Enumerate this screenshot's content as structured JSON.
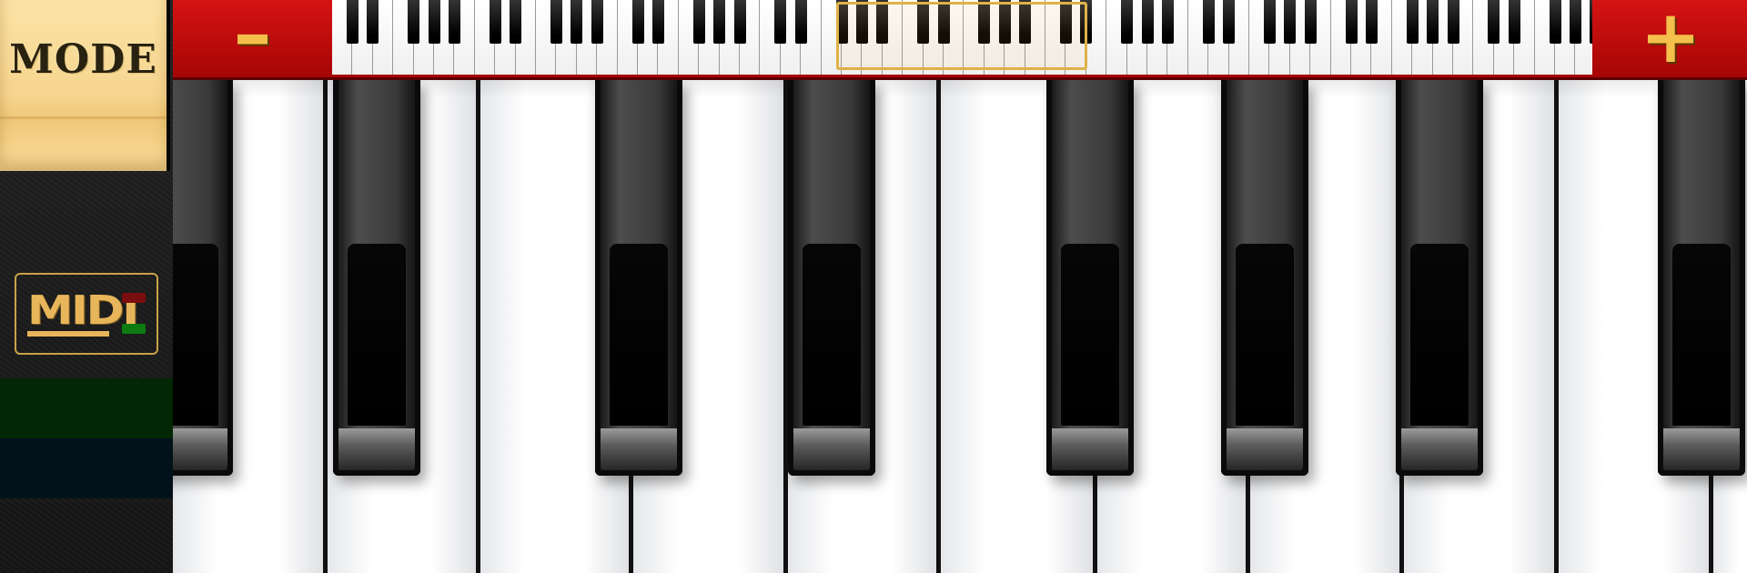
{
  "left_panel": {
    "mode_button": {
      "label": "MODE"
    },
    "midi_button": {
      "label": "MIDI",
      "led_in_color": "#7a0d0d",
      "led_out_color": "#0c7c12"
    }
  },
  "top_bar": {
    "zoom_out_symbol": "–",
    "zoom_in_symbol": "+",
    "accent_color": "#d51313",
    "highlight_color": "#e0b04a"
  },
  "keyboard": {
    "black_key_positions_in_octave": [
      0,
      1,
      3,
      4,
      5
    ],
    "visible_white_keys": 11,
    "visible_black_keys": 8
  },
  "icons": {
    "zoom_out": "minus-icon",
    "zoom_in": "plus-icon",
    "midi": "midi-icon"
  }
}
